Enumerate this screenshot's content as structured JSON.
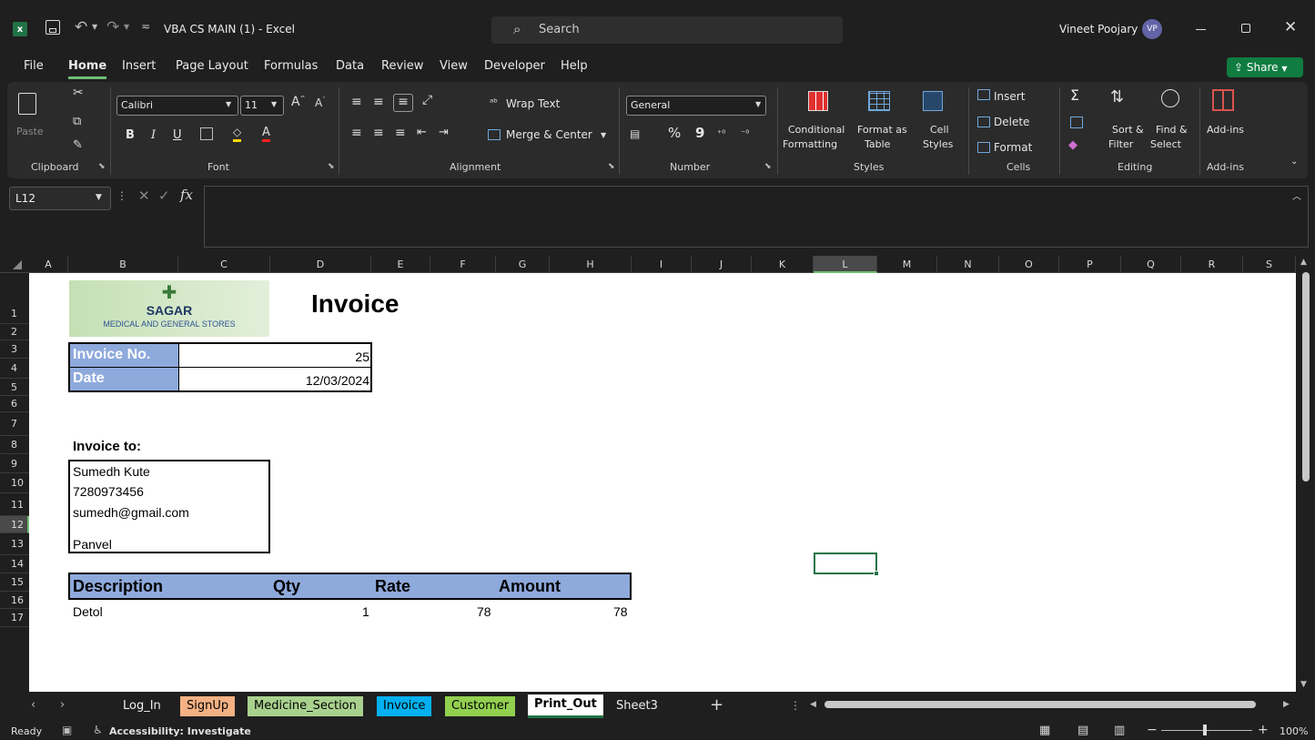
{
  "title_bar": {
    "autosave_icon": "save-icon",
    "doc_title": "VBA CS MAIN (1)  -  Excel",
    "search_placeholder": "Search",
    "user_name": "Vineet Poojary",
    "user_initials": "VP"
  },
  "ribbon_tabs": [
    "File",
    "Home",
    "Insert",
    "Page Layout",
    "Formulas",
    "Data",
    "Review",
    "View",
    "Developer",
    "Help"
  ],
  "active_tab": "Home",
  "share_label": "Share",
  "ribbon": {
    "clipboard": {
      "paste": "Paste",
      "label": "Clipboard"
    },
    "font": {
      "name": "Calibri",
      "size": "11",
      "label": "Font",
      "bold": "B",
      "italic": "I",
      "underline": "U"
    },
    "alignment": {
      "wrap": "Wrap Text",
      "merge": "Merge & Center",
      "label": "Alignment"
    },
    "number": {
      "format": "General",
      "percent": "%",
      "comma": "9",
      "label": "Number"
    },
    "styles": {
      "cond_line1": "Conditional",
      "cond_line2": "Formatting",
      "fmt_line1": "Format as",
      "fmt_line2": "Table",
      "cell_line1": "Cell",
      "cell_line2": "Styles",
      "label": "Styles"
    },
    "cells": {
      "insert": "Insert",
      "delete": "Delete",
      "format": "Format",
      "label": "Cells"
    },
    "editing": {
      "sum": "Σ",
      "sort_line1": "Sort &",
      "sort_line2": "Filter",
      "find_line1": "Find &",
      "find_line2": "Select",
      "label": "Editing"
    },
    "addins": {
      "label_top": "Add-ins",
      "label": "Add-ins"
    }
  },
  "formula_bar": {
    "name_box": "L12",
    "fx": "fx",
    "formula": ""
  },
  "columns": [
    "A",
    "B",
    "C",
    "D",
    "E",
    "F",
    "G",
    "H",
    "I",
    "J",
    "K",
    "L",
    "M",
    "N",
    "O",
    "P",
    "Q",
    "R",
    "S"
  ],
  "rows": [
    "1",
    "2",
    "3",
    "4",
    "5",
    "6",
    "7",
    "8",
    "9",
    "10",
    "11",
    "12",
    "13",
    "14",
    "15",
    "16",
    "17"
  ],
  "selected_cell": "L12",
  "invoice": {
    "logo_name": "SAGAR",
    "logo_sub": "MEDICAL AND GENERAL STORES",
    "title": "Invoice",
    "invoice_no_label": "Invoice No.",
    "invoice_no": "25",
    "date_label": "Date",
    "date": "12/03/2024",
    "invoice_to_label": "Invoice to:",
    "customer": {
      "name": "Sumedh Kute",
      "phone": "7280973456",
      "email": "sumedh@gmail.com",
      "city": "Panvel"
    },
    "table_headers": [
      "Description",
      "Qty",
      "Rate",
      "Amount"
    ],
    "items": [
      {
        "description": "Detol",
        "qty": "1",
        "rate": "78",
        "amount": "78"
      }
    ]
  },
  "sheet_tabs": [
    {
      "name": "Log_In",
      "color": ""
    },
    {
      "name": "SignUp",
      "color": "#f4b183"
    },
    {
      "name": "Medicine_Section",
      "color": "#a9d18e"
    },
    {
      "name": "Invoice",
      "color": "#00b0f0"
    },
    {
      "name": "Customer",
      "color": "#92d050"
    },
    {
      "name": "Print_Out",
      "color": "#ffffff"
    },
    {
      "name": "Sheet3",
      "color": ""
    }
  ],
  "active_sheet": "Print_Out",
  "status": {
    "ready": "Ready",
    "accessibility": "Accessibility: Investigate",
    "zoom": "100%"
  },
  "colors": {
    "header_fill": "#8ea9db",
    "excel_green": "#217346",
    "share_green": "#107c41",
    "avatar": "#6264a7"
  }
}
